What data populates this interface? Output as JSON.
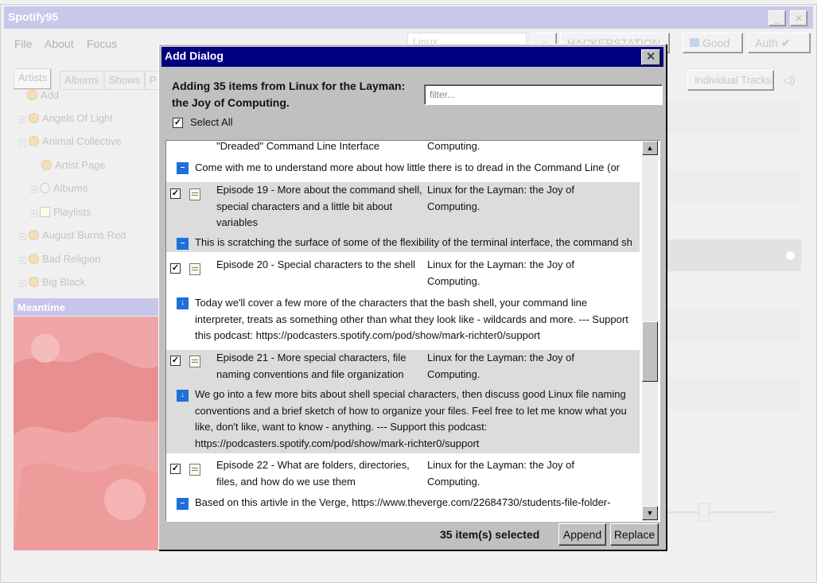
{
  "app": {
    "title": "Spotify95",
    "window_buttons": {
      "minimize": "_",
      "close": "✕"
    }
  },
  "menu": [
    "File",
    "About",
    "Focus"
  ],
  "toolbar": {
    "search_value": "Linux",
    "search_icon": "search-icon",
    "device_label": "HACKERSTATION",
    "good_label": "Good",
    "auth_label": "Auth",
    "auth_icon": "check-icon"
  },
  "tabs": [
    "Artists",
    "Albums",
    "Shows",
    "P"
  ],
  "right_panel": {
    "individual_tracks_label": "Individual Tracks",
    "speaker_icon": "speaker-icon"
  },
  "artists_tree": [
    {
      "label": "Add",
      "depth": 1
    },
    {
      "label": "Angels Of Light",
      "depth": 0
    },
    {
      "label": "Animal Collective",
      "depth": 0
    },
    {
      "label": "Artist Page",
      "depth": 2
    },
    {
      "label": "Albums",
      "depth": 1
    },
    {
      "label": "Playlists",
      "depth": 1
    },
    {
      "label": "August Burns Red",
      "depth": 0
    },
    {
      "label": "Bad Religion",
      "depth": 0
    },
    {
      "label": "Big Black",
      "depth": 0
    }
  ],
  "now_playing": {
    "title": "Meantime"
  },
  "dialog": {
    "title": "Add Dialog",
    "close_label": "✕",
    "heading": "Adding 35 items from Linux for the Layman: the Joy of Computing.",
    "filter_placeholder": "filter...",
    "select_all_label": "Select All",
    "select_all_checked": true,
    "selected_count_label": "35 item(s) selected",
    "append_label": "Append",
    "replace_label": "Replace",
    "scroll_up": "▲",
    "scroll_down": "▼",
    "rows": {
      "ep18_title_tail": "\"Dreaded\" Command Line Interface",
      "ep18_podcast_tail": "Computing.",
      "ep18_desc": "Come with me to understand more about how little there is to dread in the Command Line (or",
      "ep19_title": "Episode 19 - More about the command shell, special characters and a little bit about variables",
      "ep19_podcast": "Linux for the Layman: the Joy of Computing.",
      "ep19_desc": "This is scratching the surface of some of the flexibility of the terminal interface, the command shell",
      "ep20_title": "Episode 20 - Special characters to the shell",
      "ep20_podcast": "Linux for the Layman: the Joy of Computing.",
      "ep20_desc": "Today we'll cover a few more of the characters that the bash shell, your command line interpreter, treats as something other than what they look like - wildcards and more. --- Support this podcast: https://podcasters.spotify.com/pod/show/mark-richter0/support",
      "ep21_title": "Episode 21 - More special characters, file naming conventions and file organization",
      "ep21_podcast": "Linux for the Layman: the Joy of Computing.",
      "ep21_desc": "We go into a few more bits about shell special characters, then discuss good Linux file naming conventions and a brief sketch of how to organize your files.  Feel free to let me know what you like, don't like, want to know - anything. --- Support this podcast: https://podcasters.spotify.com/pod/show/mark-richter0/support",
      "ep22_title": "Episode 22 - What are folders, directories, files, and how do we use them",
      "ep22_podcast": "Linux for the Layman: the Joy of Computing.",
      "ep22_desc": "Based on this artivle in the Verge, https://www.theverge.com/22684730/students-file-folder-"
    }
  }
}
